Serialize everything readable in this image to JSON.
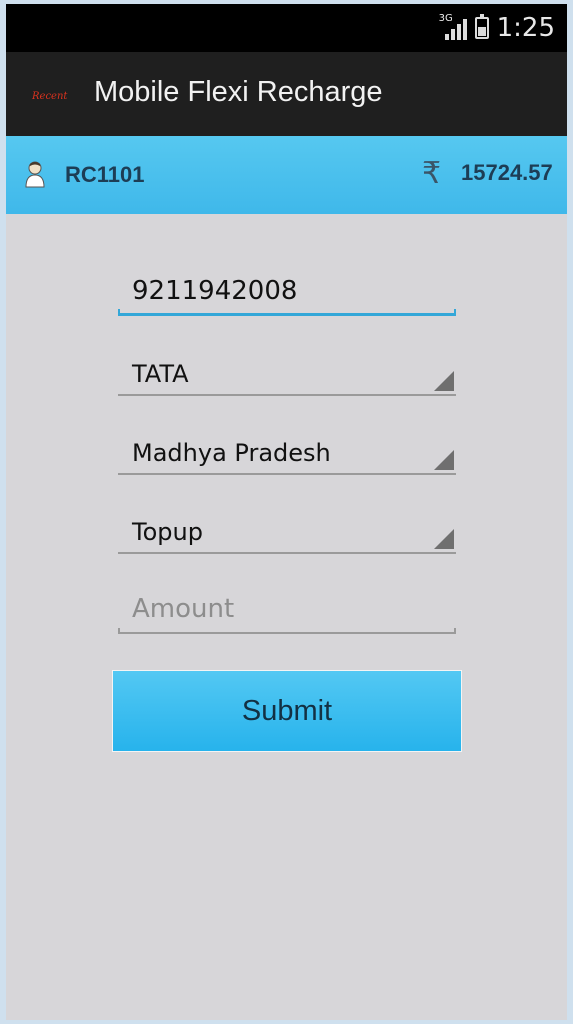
{
  "status_bar": {
    "network_type": "3G",
    "time": "1:25"
  },
  "action_bar": {
    "title": "Mobile Flexi Recharge",
    "logo_text": "Recent"
  },
  "account_bar": {
    "user_id": "RC1101",
    "currency_icon": "rupee-icon",
    "balance": "15724.57"
  },
  "form": {
    "mobile_number": "9211942008",
    "operator_selected": "TATA",
    "circle_selected": "Madhya Pradesh",
    "recharge_type_selected": "Topup",
    "amount_value": "",
    "amount_placeholder": "Amount",
    "submit_label": "Submit"
  },
  "colors": {
    "status_bar_bg": "#000000",
    "action_bar_bg": "#1f1f1f",
    "info_bar_bg": "#4cc2ee",
    "content_bg": "#d7d6d9",
    "focus_line": "#33a7d8",
    "button_bg": "#3dbdf0"
  }
}
